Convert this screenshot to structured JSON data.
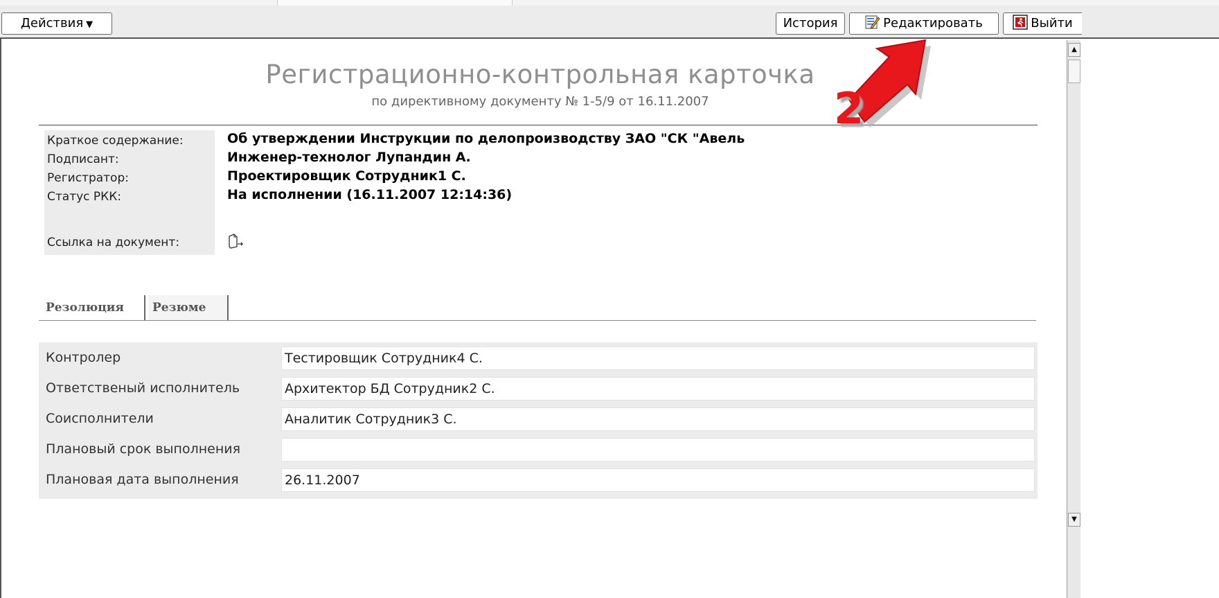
{
  "toolbar": {
    "actions_label": "Действия",
    "history_label": "История",
    "edit_label": "Редактировать",
    "exit_label": "Выйти"
  },
  "card": {
    "title": "Регистрационно-контрольная карточка",
    "subtitle": "по директивному документу № 1-5/9 от 16.11.2007"
  },
  "info": [
    {
      "label": "Краткое содержание:",
      "value": "Об утверждении Инструкции по делопроизводству ЗАО \"СК \"Авель"
    },
    {
      "label": "Подписант:",
      "value": "Инженер-технолог Лупандин А."
    },
    {
      "label": "Регистратор:",
      "value": "Проектировщик Сотрудник1 С."
    },
    {
      "label": "Статус РКК:",
      "value": "На исполнении (16.11.2007 12:14:36)"
    }
  ],
  "doc_link": {
    "label": "Ссылка на документ:"
  },
  "tabs": [
    "Резолюция",
    "Резюме"
  ],
  "resolution": [
    {
      "label": "Контролер",
      "value": "Тестировщик Сотрудник4 С."
    },
    {
      "label": "Ответственый исполнитель",
      "value": "Архитектор БД Сотрудник2 С."
    },
    {
      "label": "Соисполнители",
      "value": "Аналитик Сотрудник3 С."
    },
    {
      "label": "Плановый срок выполнения",
      "value": ""
    },
    {
      "label": "Плановая дата выполнения",
      "value": "26.11.2007"
    }
  ],
  "annotation": {
    "number": "2",
    "color": "#e8171b"
  },
  "icons": {
    "actions_caret": "chevron-down-icon",
    "edit": "edit-document-icon",
    "exit": "exit-icon",
    "doc_link": "document-link-icon",
    "scroll_up": "arrow-up-icon",
    "scroll_down": "arrow-down-icon"
  }
}
